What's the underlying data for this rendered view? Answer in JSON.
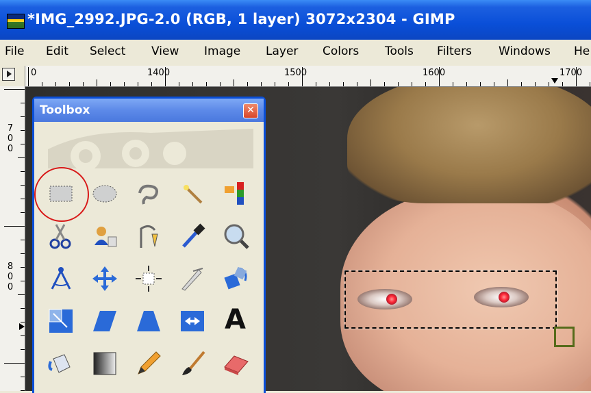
{
  "window": {
    "title": "*IMG_2992.JPG-2.0 (RGB, 1 layer) 3072x2304 - GIMP",
    "icon": "gimp-app-icon"
  },
  "menubar": {
    "items": [
      "File",
      "Edit",
      "Select",
      "View",
      "Image",
      "Layer",
      "Colors",
      "Tools",
      "Filters",
      "Windows",
      "He"
    ]
  },
  "rulers": {
    "horizontal_labels": [
      "0",
      "1400",
      "1500",
      "1600",
      "1700"
    ],
    "vertical_labels": [
      "7",
      "0",
      "0",
      "8",
      "0",
      "0"
    ]
  },
  "toolbox": {
    "title": "Toolbox",
    "close_symbol": "✕",
    "tools": [
      [
        "rect-select-icon",
        "ellipse-select-icon",
        "free-select-icon",
        "fuzzy-select-icon",
        "select-by-color-icon"
      ],
      [
        "scissors-icon",
        "foreground-select-icon",
        "paths-icon",
        "color-picker-icon",
        "zoom-icon"
      ],
      [
        "measure-icon",
        "move-icon",
        "align-icon",
        "crop-icon",
        "rotate-icon"
      ],
      [
        "scale-icon",
        "shear-icon",
        "perspective-icon",
        "flip-icon",
        "text-icon"
      ],
      [
        "bucket-fill-icon",
        "blend-icon",
        "pencil-icon",
        "paintbrush-icon",
        "eraser-icon"
      ]
    ]
  },
  "text_tool_glyph": "A"
}
